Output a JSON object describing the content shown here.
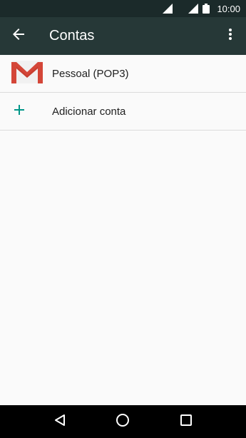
{
  "status_bar": {
    "time": "10:00",
    "icons": [
      "signal-icon",
      "signal-icon",
      "battery-icon"
    ]
  },
  "app_bar": {
    "title": "Contas",
    "back_icon": "arrow-back-icon",
    "menu_icon": "more-vert-icon"
  },
  "accounts": {
    "items": [
      {
        "label": "Pessoal (POP3)",
        "icon": "gmail-icon"
      },
      {
        "label": "Adicionar conta",
        "icon": "add-icon"
      }
    ]
  },
  "nav_bar": {
    "icons": [
      "back-triangle-icon",
      "home-circle-icon",
      "recents-square-icon"
    ]
  },
  "colors": {
    "status_bar": "#1b2a2a",
    "app_bar": "#263837",
    "accent": "#009688",
    "gmail_red": "#d44638"
  }
}
